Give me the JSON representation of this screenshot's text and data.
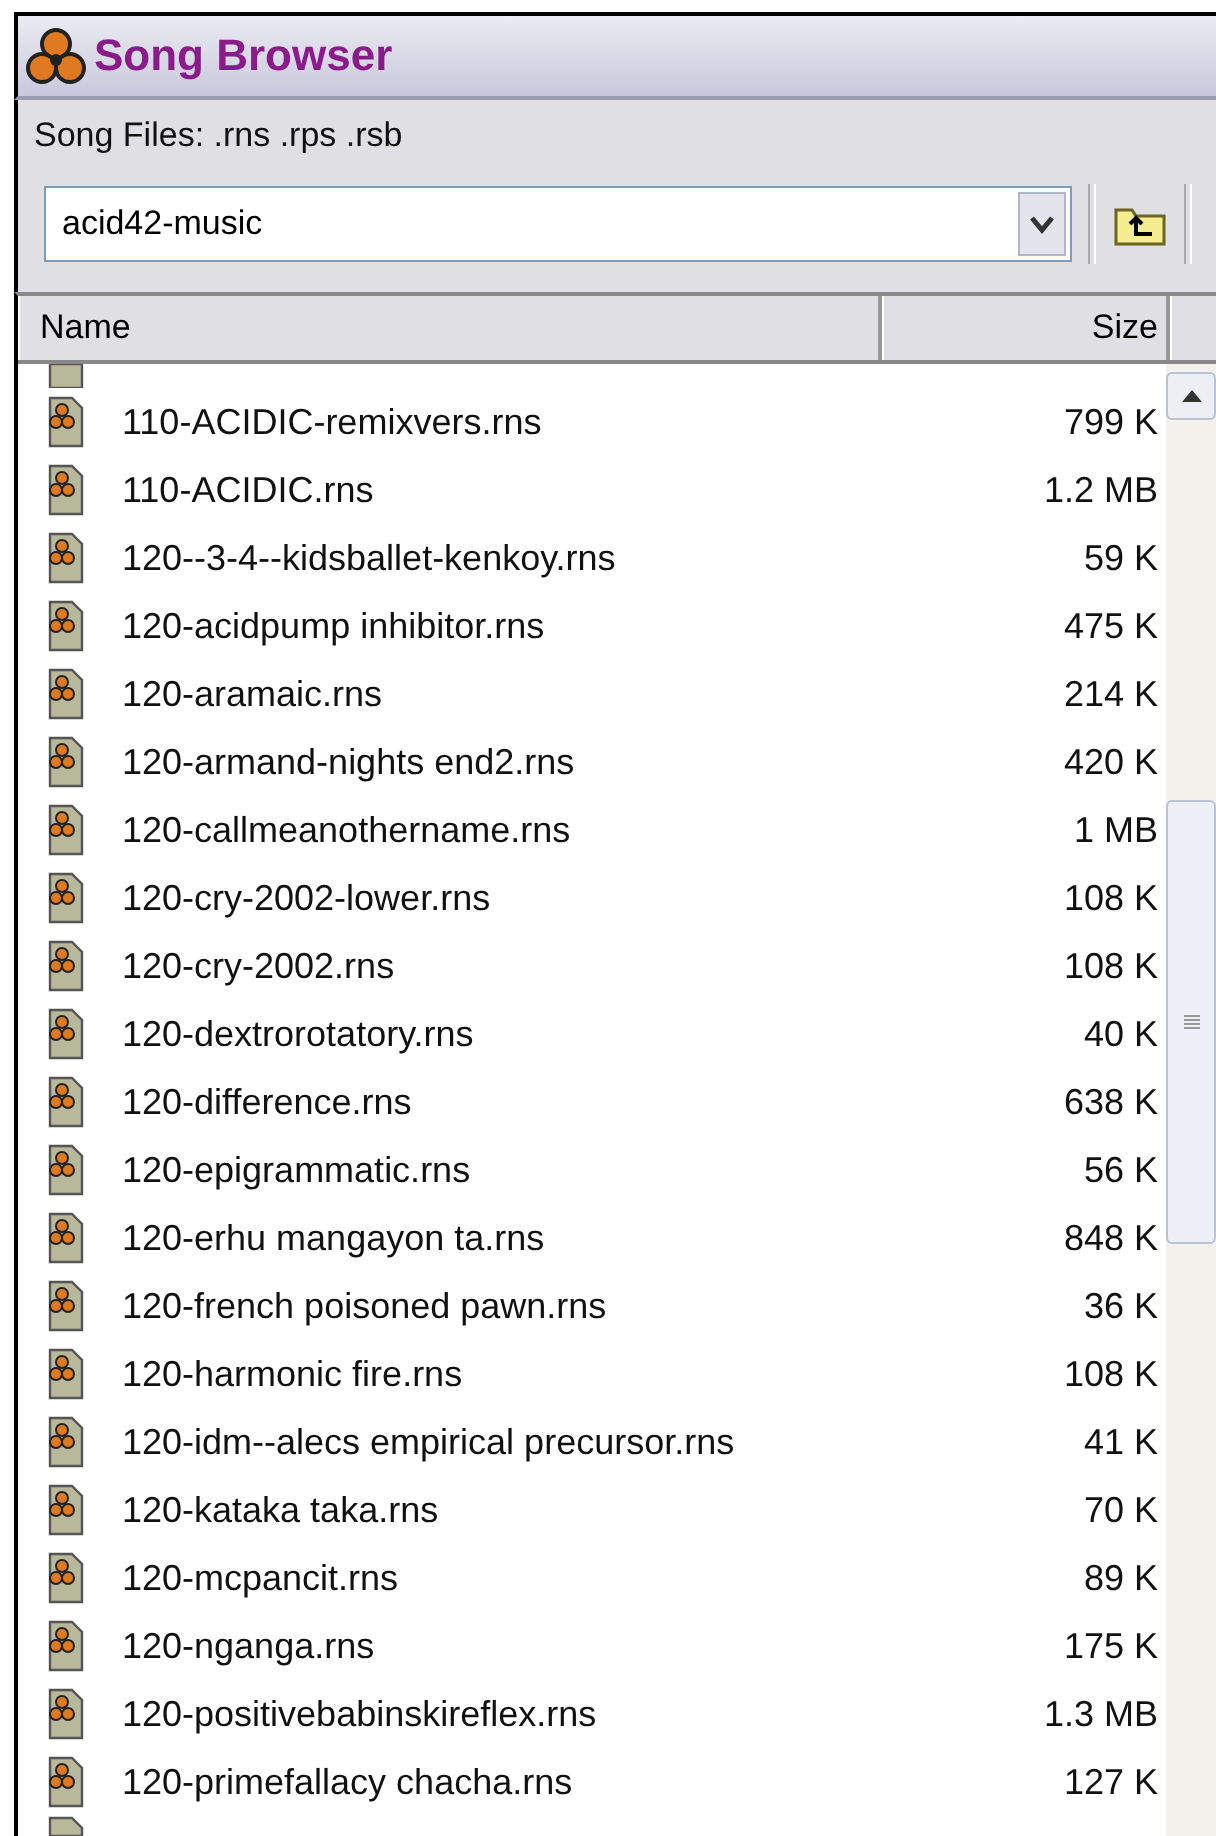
{
  "window": {
    "title": "Song Browser"
  },
  "filter_label": "Song Files: .rns .rps .rsb",
  "folder": {
    "value": "acid42-music"
  },
  "table": {
    "columns": [
      "Name",
      "Size"
    ],
    "rows": [
      {
        "name": "110-ACIDIC-remixvers.rns",
        "size": "799 K"
      },
      {
        "name": "110-ACIDIC.rns",
        "size": "1.2 MB"
      },
      {
        "name": "120--3-4--kidsballet-kenkoy.rns",
        "size": "59 K"
      },
      {
        "name": "120-acidpump inhibitor.rns",
        "size": "475 K"
      },
      {
        "name": "120-aramaic.rns",
        "size": "214 K"
      },
      {
        "name": "120-armand-nights end2.rns",
        "size": "420 K"
      },
      {
        "name": "120-callmeanothername.rns",
        "size": "1 MB"
      },
      {
        "name": "120-cry-2002-lower.rns",
        "size": "108 K"
      },
      {
        "name": "120-cry-2002.rns",
        "size": "108 K"
      },
      {
        "name": "120-dextrorotatory.rns",
        "size": "40 K"
      },
      {
        "name": "120-difference.rns",
        "size": "638 K"
      },
      {
        "name": "120-epigrammatic.rns",
        "size": "56 K"
      },
      {
        "name": "120-erhu mangayon ta.rns",
        "size": "848 K"
      },
      {
        "name": "120-french poisoned pawn.rns",
        "size": "36 K"
      },
      {
        "name": "120-harmonic fire.rns",
        "size": "108 K"
      },
      {
        "name": "120-idm--alecs empirical precursor.rns",
        "size": "41 K"
      },
      {
        "name": "120-kataka taka.rns",
        "size": "70 K"
      },
      {
        "name": "120-mcpancit.rns",
        "size": "89 K"
      },
      {
        "name": "120-nganga.rns",
        "size": "175 K"
      },
      {
        "name": "120-positivebabinskireflex.rns",
        "size": "1.3 MB"
      },
      {
        "name": "120-primefallacy chacha.rns",
        "size": "127 K"
      }
    ]
  }
}
